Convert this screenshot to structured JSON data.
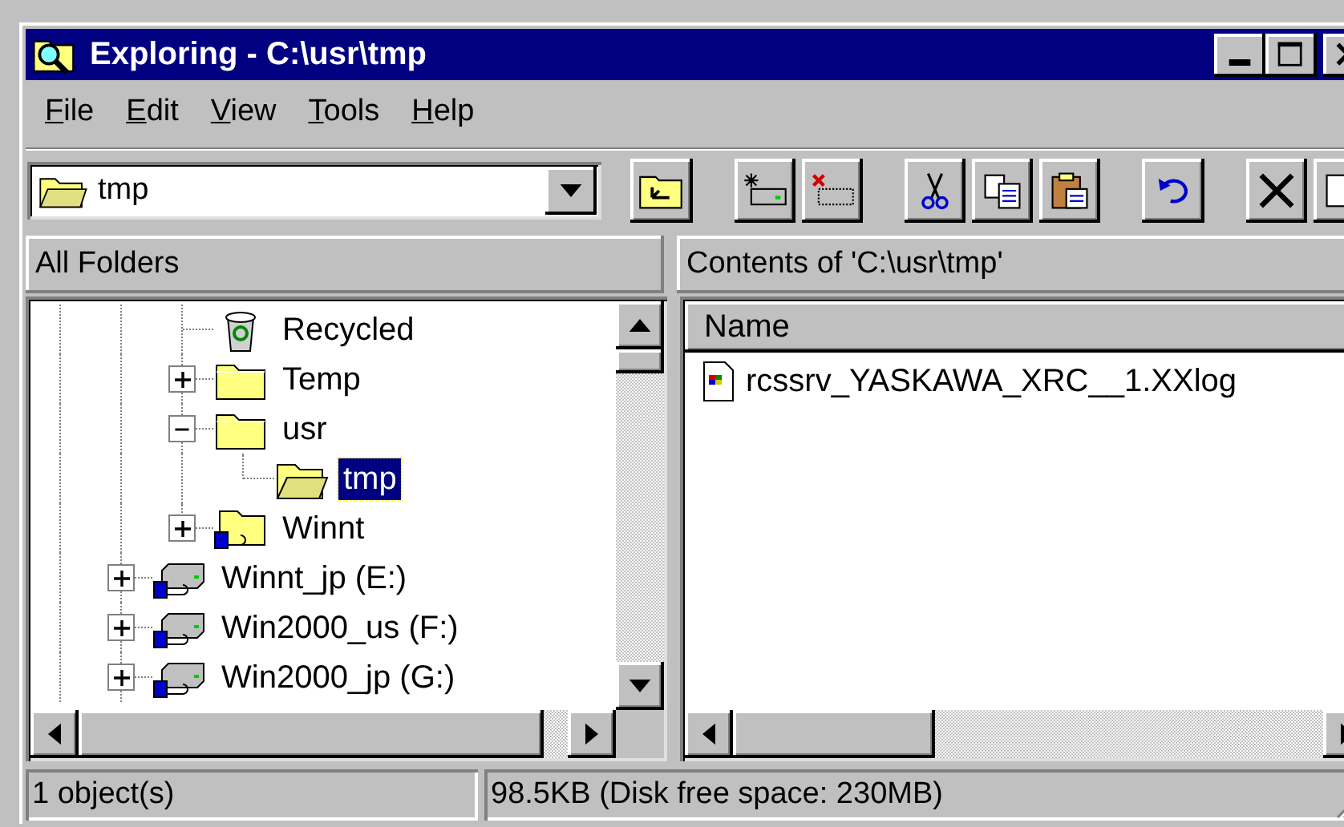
{
  "window": {
    "title": "Exploring - C:\\usr\\tmp"
  },
  "menu": [
    "File",
    "Edit",
    "View",
    "Tools",
    "Help"
  ],
  "address": {
    "value": "tmp"
  },
  "folders_pane": {
    "title": "All Folders"
  },
  "tree": [
    {
      "children": [
        {
          "label": "Recycled",
          "kind": "recycle-bin",
          "expandable": false,
          "selected": false
        },
        {
          "label": "Temp",
          "kind": "folder",
          "expandable": true,
          "expanded": false,
          "selected": false
        },
        {
          "label": "usr",
          "kind": "folder",
          "expandable": true,
          "expanded": true,
          "selected": false,
          "children": [
            {
              "label": "tmp",
              "kind": "folder-open",
              "expandable": false,
              "selected": true
            }
          ]
        },
        {
          "label": "Winnt",
          "kind": "network-folder",
          "expandable": true,
          "expanded": false,
          "selected": false
        }
      ]
    },
    {
      "label": "Winnt_jp (E:)",
      "kind": "network-drive",
      "expandable": true,
      "expanded": false,
      "selected": false
    },
    {
      "label": "Win2000_us (F:)",
      "kind": "network-drive",
      "expandable": true,
      "expanded": false,
      "selected": false
    },
    {
      "label": "Win2000_jp (G:)",
      "kind": "network-drive",
      "expandable": true,
      "expanded": false,
      "selected": false
    }
  ],
  "contents_pane": {
    "title": "Contents of 'C:\\usr\\tmp'",
    "columns": [
      "Name"
    ],
    "files": [
      {
        "name": "rcssrv_YASKAWA_XRC__1.XXlog"
      }
    ]
  },
  "status_bar": [
    "1 object(s)",
    "98.5KB (Disk free space: 230MB)"
  ]
}
